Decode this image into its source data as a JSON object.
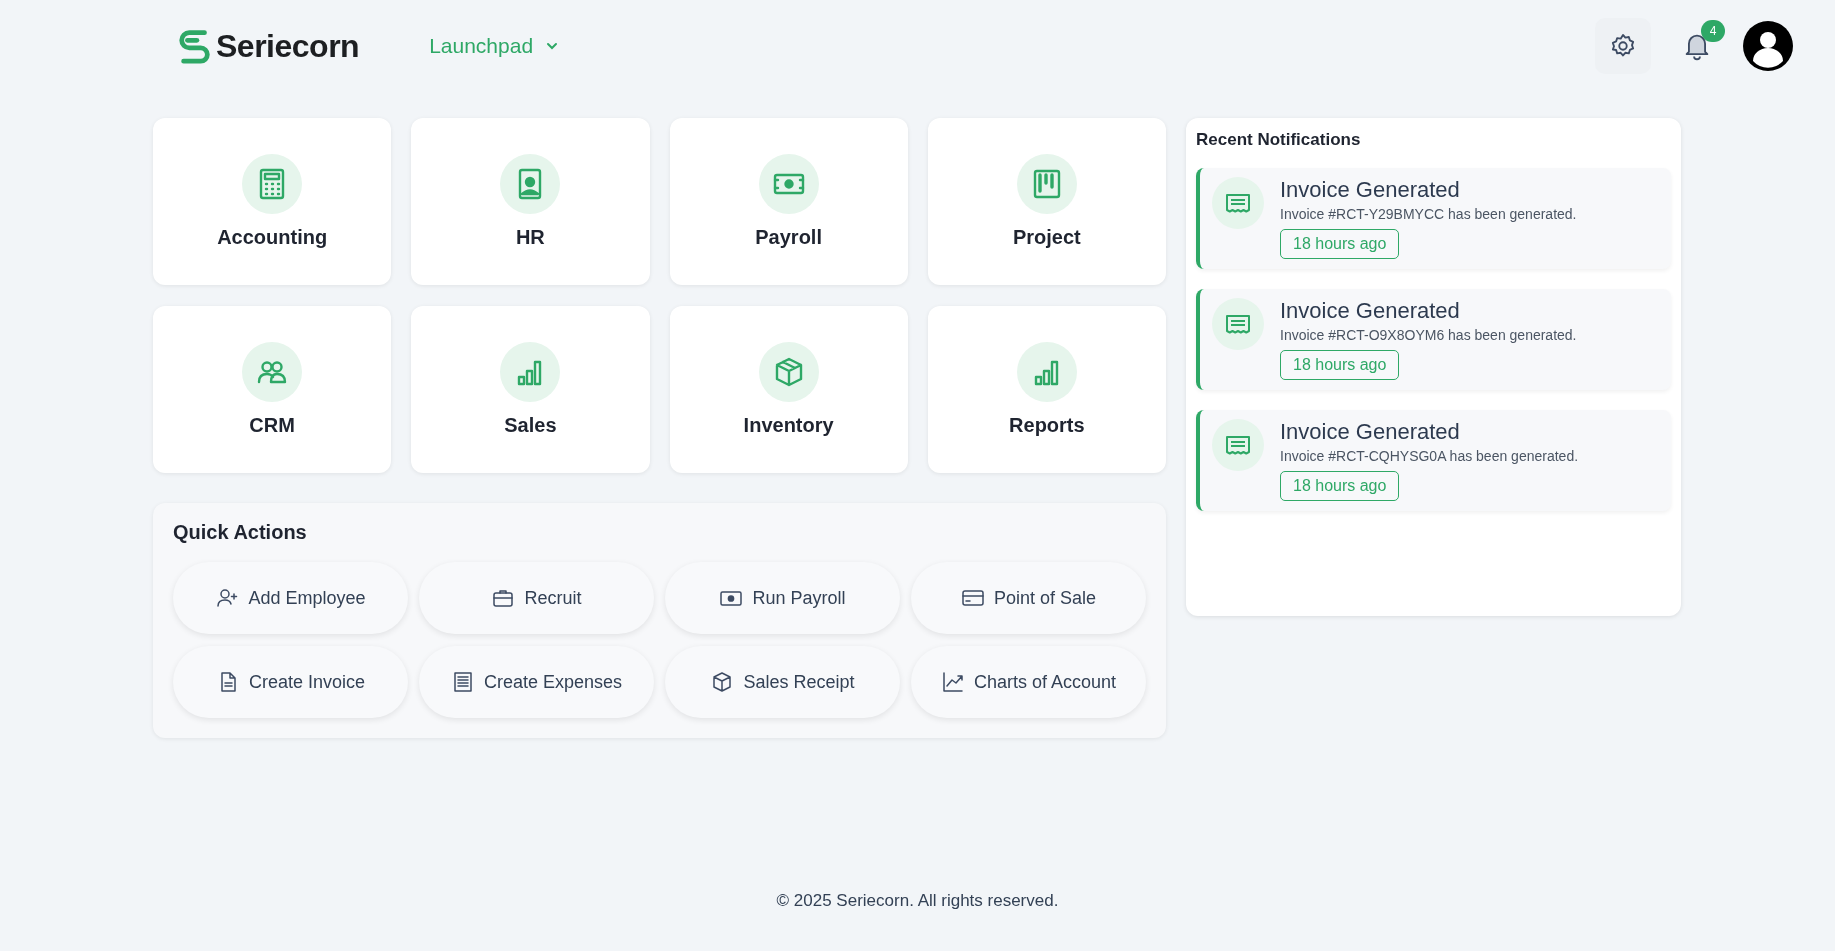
{
  "header": {
    "brand": "Seriecorn",
    "menu": {
      "label": "Launchpad"
    },
    "notification_count": "4"
  },
  "apps": [
    {
      "label": "Accounting"
    },
    {
      "label": "HR"
    },
    {
      "label": "Payroll"
    },
    {
      "label": "Project"
    },
    {
      "label": "CRM"
    },
    {
      "label": "Sales"
    },
    {
      "label": "Inventory"
    },
    {
      "label": "Reports"
    }
  ],
  "quick_actions": {
    "title": "Quick Actions",
    "items": [
      {
        "label": "Add Employee"
      },
      {
        "label": "Recruit"
      },
      {
        "label": "Run Payroll"
      },
      {
        "label": "Point of Sale"
      },
      {
        "label": "Create Invoice"
      },
      {
        "label": "Create Expenses"
      },
      {
        "label": "Sales Receipt"
      },
      {
        "label": "Charts of Account"
      }
    ]
  },
  "notifications": {
    "title": "Recent Notifications",
    "items": [
      {
        "title": "Invoice Generated",
        "message": "Invoice #RCT-Y29BMYCC has been generated.",
        "time": "18 hours ago"
      },
      {
        "title": "Invoice Generated",
        "message": "Invoice #RCT-O9X8OYM6 has been generated.",
        "time": "18 hours ago"
      },
      {
        "title": "Invoice Generated",
        "message": "Invoice #RCT-CQHYSG0A has been generated.",
        "time": "18 hours ago"
      }
    ]
  },
  "footer": "© 2025 Seriecorn. All rights reserved."
}
